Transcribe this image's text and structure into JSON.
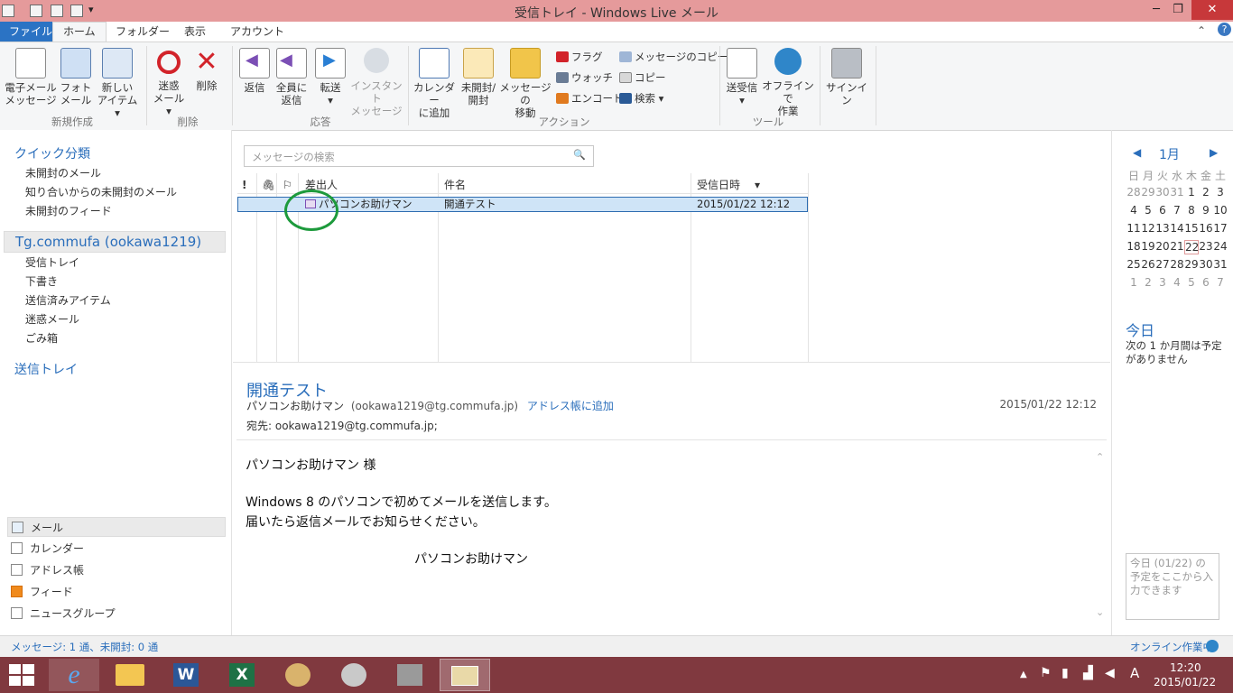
{
  "window": {
    "title": "受信トレイ - Windows Live メール",
    "minimize": "─",
    "maximize": "❐",
    "close": "✕"
  },
  "tabs": [
    "ファイル",
    "ホーム",
    "フォルダー",
    "表示",
    "アカウント"
  ],
  "ribbon": {
    "buttons": {
      "new_email": "電子メール\nメッセージ",
      "photo_email": "フォト\nメール",
      "new_items": "新しい\nアイテム ▾",
      "junk": "迷惑\nメール ▾",
      "delete": "削除",
      "reply": "返信",
      "reply_all": "全員に\n返信",
      "forward": "転送\n▾",
      "instant_message": "インスタント\nメッセージ",
      "add_to_calendar": "カレンダー\nに追加",
      "unread_read": "未開封/\n開封",
      "move_to": "メッセージの\n移動",
      "send_receive": "送受信\n▾",
      "work_offline": "オフラインで\n作業",
      "sign_in": "サインイン"
    },
    "small": {
      "flag": "フラグ",
      "watch": "ウォッチ",
      "encode": "エンコード",
      "copy_to": "メッセージのコピー",
      "copy": "コピー",
      "find": "検索 ▾"
    },
    "groups": {
      "new": "新規作成",
      "delete": "削除",
      "respond": "応答",
      "actions": "アクション",
      "tools": "ツール"
    }
  },
  "nav": {
    "quick_views_title": "クイック分類",
    "quick_views": [
      "未開封のメール",
      "知り合いからの未開封のメール",
      "未開封のフィード"
    ],
    "account": "Tg.commufa (ookawa1219)",
    "folders": [
      "受信トレイ",
      "下書き",
      "送信済みアイテム",
      "迷惑メール",
      "ごみ箱"
    ],
    "outbox": "送信トレイ",
    "bottom": [
      "メール",
      "カレンダー",
      "アドレス帳",
      "フィード",
      "ニュースグループ"
    ]
  },
  "search": {
    "placeholder": "メッセージの検索",
    "icon": "🔍"
  },
  "list": {
    "headers": {
      "importance": "!",
      "attachment": "🖇",
      "flag": "⚐",
      "from": "差出人",
      "subject": "件名",
      "date": "受信日時",
      "sort": "▾"
    },
    "row": {
      "from": "パソコンお助けマン",
      "subject": "開通テスト",
      "date": "2015/01/22 12:12"
    }
  },
  "preview": {
    "subject": "開通テスト",
    "from_name": "パソコンお助けマン",
    "from_email": "(ookawa1219@tg.commufa.jp)",
    "add_contact": "アドレス帳に追加",
    "to": "宛先: ookawa1219@tg.commufa.jp;",
    "date": "2015/01/22 12:12",
    "body": {
      "salutation": "パソコンお助けマン 様",
      "line1": "Windows 8 のパソコンで初めてメールを送信します。",
      "line2": "届いたら返信メールでお知らせください。",
      "signature": "パソコンお助けマン"
    }
  },
  "calendar": {
    "month": "1月",
    "prev": "◀",
    "next": "▶",
    "weekdays": [
      "日",
      "月",
      "火",
      "水",
      "木",
      "金",
      "土"
    ],
    "weeks": [
      [
        "28",
        "29",
        "30",
        "31",
        "1",
        "2",
        "3"
      ],
      [
        "4",
        "5",
        "6",
        "7",
        "8",
        "9",
        "10"
      ],
      [
        "11",
        "12",
        "13",
        "14",
        "15",
        "16",
        "17"
      ],
      [
        "18",
        "19",
        "20",
        "21",
        "22",
        "23",
        "24"
      ],
      [
        "25",
        "26",
        "27",
        "28",
        "29",
        "30",
        "31"
      ],
      [
        "1",
        "2",
        "3",
        "4",
        "5",
        "6",
        "7"
      ]
    ],
    "today": "22"
  },
  "today": {
    "title": "今日",
    "text": "次の 1 か月間は予定がありません",
    "input_placeholder": "今日 (01/22) の予定をここから入力できます"
  },
  "status": {
    "left": "メッセージ: 1 通、未開封: 0 通",
    "right": "オンライン作業中"
  },
  "taskbar": {
    "time": "12:20",
    "date": "2015/01/22",
    "ime": "A"
  }
}
